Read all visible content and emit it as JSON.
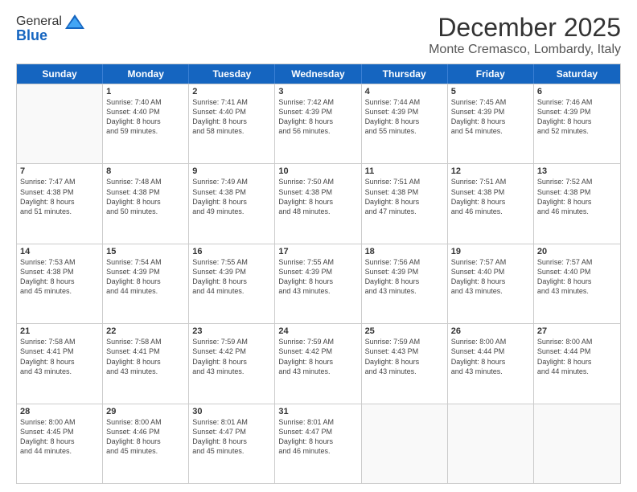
{
  "logo": {
    "general": "General",
    "blue": "Blue"
  },
  "header": {
    "month": "December 2025",
    "location": "Monte Cremasco, Lombardy, Italy"
  },
  "weekdays": [
    "Sunday",
    "Monday",
    "Tuesday",
    "Wednesday",
    "Thursday",
    "Friday",
    "Saturday"
  ],
  "rows": [
    [
      {
        "day": "",
        "sunrise": "",
        "sunset": "",
        "daylight": "",
        "empty": true
      },
      {
        "day": "1",
        "sunrise": "Sunrise: 7:40 AM",
        "sunset": "Sunset: 4:40 PM",
        "daylight": "Daylight: 8 hours and 59 minutes."
      },
      {
        "day": "2",
        "sunrise": "Sunrise: 7:41 AM",
        "sunset": "Sunset: 4:40 PM",
        "daylight": "Daylight: 8 hours and 58 minutes."
      },
      {
        "day": "3",
        "sunrise": "Sunrise: 7:42 AM",
        "sunset": "Sunset: 4:39 PM",
        "daylight": "Daylight: 8 hours and 56 minutes."
      },
      {
        "day": "4",
        "sunrise": "Sunrise: 7:44 AM",
        "sunset": "Sunset: 4:39 PM",
        "daylight": "Daylight: 8 hours and 55 minutes."
      },
      {
        "day": "5",
        "sunrise": "Sunrise: 7:45 AM",
        "sunset": "Sunset: 4:39 PM",
        "daylight": "Daylight: 8 hours and 54 minutes."
      },
      {
        "day": "6",
        "sunrise": "Sunrise: 7:46 AM",
        "sunset": "Sunset: 4:39 PM",
        "daylight": "Daylight: 8 hours and 52 minutes."
      }
    ],
    [
      {
        "day": "7",
        "sunrise": "Sunrise: 7:47 AM",
        "sunset": "Sunset: 4:38 PM",
        "daylight": "Daylight: 8 hours and 51 minutes."
      },
      {
        "day": "8",
        "sunrise": "Sunrise: 7:48 AM",
        "sunset": "Sunset: 4:38 PM",
        "daylight": "Daylight: 8 hours and 50 minutes."
      },
      {
        "day": "9",
        "sunrise": "Sunrise: 7:49 AM",
        "sunset": "Sunset: 4:38 PM",
        "daylight": "Daylight: 8 hours and 49 minutes."
      },
      {
        "day": "10",
        "sunrise": "Sunrise: 7:50 AM",
        "sunset": "Sunset: 4:38 PM",
        "daylight": "Daylight: 8 hours and 48 minutes."
      },
      {
        "day": "11",
        "sunrise": "Sunrise: 7:51 AM",
        "sunset": "Sunset: 4:38 PM",
        "daylight": "Daylight: 8 hours and 47 minutes."
      },
      {
        "day": "12",
        "sunrise": "Sunrise: 7:51 AM",
        "sunset": "Sunset: 4:38 PM",
        "daylight": "Daylight: 8 hours and 46 minutes."
      },
      {
        "day": "13",
        "sunrise": "Sunrise: 7:52 AM",
        "sunset": "Sunset: 4:38 PM",
        "daylight": "Daylight: 8 hours and 46 minutes."
      }
    ],
    [
      {
        "day": "14",
        "sunrise": "Sunrise: 7:53 AM",
        "sunset": "Sunset: 4:38 PM",
        "daylight": "Daylight: 8 hours and 45 minutes."
      },
      {
        "day": "15",
        "sunrise": "Sunrise: 7:54 AM",
        "sunset": "Sunset: 4:39 PM",
        "daylight": "Daylight: 8 hours and 44 minutes."
      },
      {
        "day": "16",
        "sunrise": "Sunrise: 7:55 AM",
        "sunset": "Sunset: 4:39 PM",
        "daylight": "Daylight: 8 hours and 44 minutes."
      },
      {
        "day": "17",
        "sunrise": "Sunrise: 7:55 AM",
        "sunset": "Sunset: 4:39 PM",
        "daylight": "Daylight: 8 hours and 43 minutes."
      },
      {
        "day": "18",
        "sunrise": "Sunrise: 7:56 AM",
        "sunset": "Sunset: 4:39 PM",
        "daylight": "Daylight: 8 hours and 43 minutes."
      },
      {
        "day": "19",
        "sunrise": "Sunrise: 7:57 AM",
        "sunset": "Sunset: 4:40 PM",
        "daylight": "Daylight: 8 hours and 43 minutes."
      },
      {
        "day": "20",
        "sunrise": "Sunrise: 7:57 AM",
        "sunset": "Sunset: 4:40 PM",
        "daylight": "Daylight: 8 hours and 43 minutes."
      }
    ],
    [
      {
        "day": "21",
        "sunrise": "Sunrise: 7:58 AM",
        "sunset": "Sunset: 4:41 PM",
        "daylight": "Daylight: 8 hours and 43 minutes."
      },
      {
        "day": "22",
        "sunrise": "Sunrise: 7:58 AM",
        "sunset": "Sunset: 4:41 PM",
        "daylight": "Daylight: 8 hours and 43 minutes."
      },
      {
        "day": "23",
        "sunrise": "Sunrise: 7:59 AM",
        "sunset": "Sunset: 4:42 PM",
        "daylight": "Daylight: 8 hours and 43 minutes."
      },
      {
        "day": "24",
        "sunrise": "Sunrise: 7:59 AM",
        "sunset": "Sunset: 4:42 PM",
        "daylight": "Daylight: 8 hours and 43 minutes."
      },
      {
        "day": "25",
        "sunrise": "Sunrise: 7:59 AM",
        "sunset": "Sunset: 4:43 PM",
        "daylight": "Daylight: 8 hours and 43 minutes."
      },
      {
        "day": "26",
        "sunrise": "Sunrise: 8:00 AM",
        "sunset": "Sunset: 4:44 PM",
        "daylight": "Daylight: 8 hours and 43 minutes."
      },
      {
        "day": "27",
        "sunrise": "Sunrise: 8:00 AM",
        "sunset": "Sunset: 4:44 PM",
        "daylight": "Daylight: 8 hours and 44 minutes."
      }
    ],
    [
      {
        "day": "28",
        "sunrise": "Sunrise: 8:00 AM",
        "sunset": "Sunset: 4:45 PM",
        "daylight": "Daylight: 8 hours and 44 minutes."
      },
      {
        "day": "29",
        "sunrise": "Sunrise: 8:00 AM",
        "sunset": "Sunset: 4:46 PM",
        "daylight": "Daylight: 8 hours and 45 minutes."
      },
      {
        "day": "30",
        "sunrise": "Sunrise: 8:01 AM",
        "sunset": "Sunset: 4:47 PM",
        "daylight": "Daylight: 8 hours and 45 minutes."
      },
      {
        "day": "31",
        "sunrise": "Sunrise: 8:01 AM",
        "sunset": "Sunset: 4:47 PM",
        "daylight": "Daylight: 8 hours and 46 minutes."
      },
      {
        "day": "",
        "sunrise": "",
        "sunset": "",
        "daylight": "",
        "empty": true
      },
      {
        "day": "",
        "sunrise": "",
        "sunset": "",
        "daylight": "",
        "empty": true
      },
      {
        "day": "",
        "sunrise": "",
        "sunset": "",
        "daylight": "",
        "empty": true
      }
    ]
  ]
}
